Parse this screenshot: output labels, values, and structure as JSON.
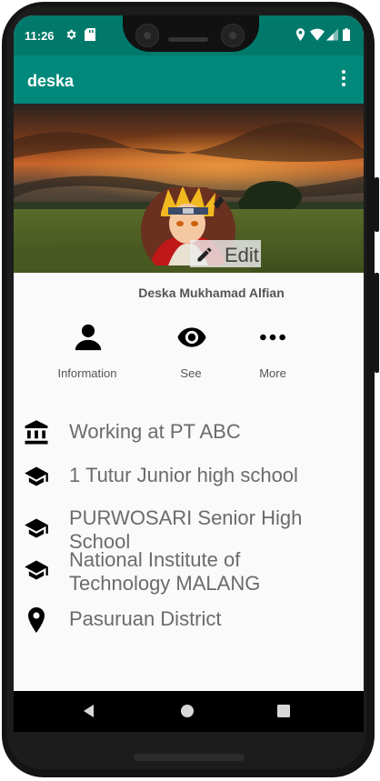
{
  "status_bar": {
    "time": "11:26",
    "icons": [
      "gear-icon",
      "sd-card-icon",
      "location-icon",
      "wifi-icon",
      "signal-icon",
      "battery-icon"
    ]
  },
  "app_bar": {
    "title": "deska",
    "menu_icon": "more-vert-icon"
  },
  "profile": {
    "edit_label": "Edit",
    "name": "Deska Mukhamad Alfian"
  },
  "actions": [
    {
      "label": "Information",
      "icon": "person-icon"
    },
    {
      "label": "See",
      "icon": "eye-icon"
    },
    {
      "label": "More",
      "icon": "more-horiz-icon"
    }
  ],
  "info": [
    {
      "icon": "bank-icon",
      "text": "Working at PT ABC"
    },
    {
      "icon": "school-icon",
      "text": "1 Tutur Junior high school"
    },
    {
      "icon": "school-icon",
      "text": "PURWOSARI Senior High School"
    },
    {
      "icon": "school-icon",
      "text": "National Institute of Technology MALANG"
    },
    {
      "icon": "location-pin-icon",
      "text": "Pasuruan District"
    }
  ],
  "colors": {
    "status_bar": "#00796b",
    "app_bar": "#00897b",
    "background": "#fafafa",
    "text": "#6b6b6b"
  }
}
